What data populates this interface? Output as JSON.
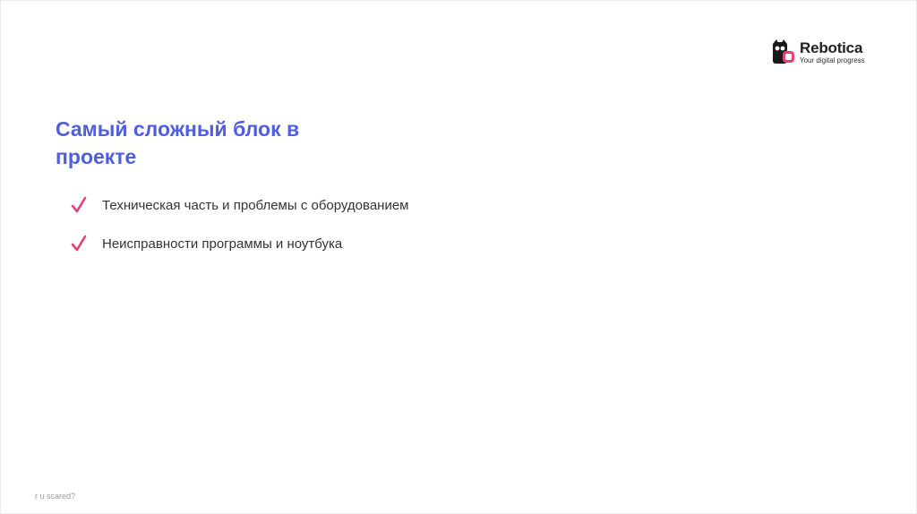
{
  "logo": {
    "name": "Rebotica",
    "tagline": "Your digital progress"
  },
  "slide": {
    "title": "Самый сложный блок в проекте",
    "items": [
      {
        "text": "Техническая часть и проблемы с оборудованием"
      },
      {
        "text": "Неисправности программы и ноутбука"
      }
    ],
    "footer": "r u scared?"
  },
  "colors": {
    "title": "#4f5de0",
    "check": "#e8417a",
    "text": "#333333"
  },
  "icons": {
    "logo": "owl-robot-icon",
    "bullet": "checkmark-icon"
  }
}
